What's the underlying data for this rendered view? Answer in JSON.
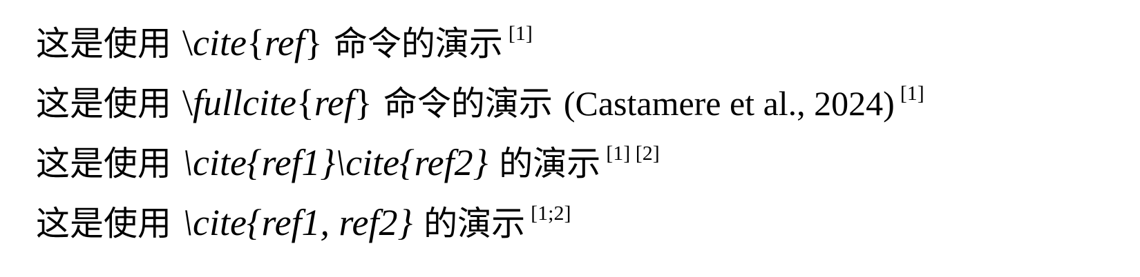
{
  "lines": [
    {
      "prefix": "这是使用",
      "command": "\\",
      "command_name": "cite",
      "lbrace": "{",
      "arg": "ref",
      "rbrace": "}",
      "suffix": "命令的演示",
      "cite_text": "",
      "superscript": "[1]"
    },
    {
      "prefix": "这是使用",
      "command": "\\",
      "command_name": "fullcite",
      "lbrace": "{",
      "arg": "ref",
      "rbrace": "}",
      "suffix": "命令的演示",
      "cite_text": "(Castamere et al., 2024)",
      "superscript": "[1]"
    },
    {
      "prefix": "这是使用",
      "command_expr": "\\cite{ref1}\\cite{ref2}",
      "suffix": "的演示",
      "superscript": "[1] [2]"
    },
    {
      "prefix": "这是使用",
      "command_expr": "\\cite{ref1, ref2}",
      "suffix": "的演示",
      "superscript": "[1;2]"
    }
  ]
}
